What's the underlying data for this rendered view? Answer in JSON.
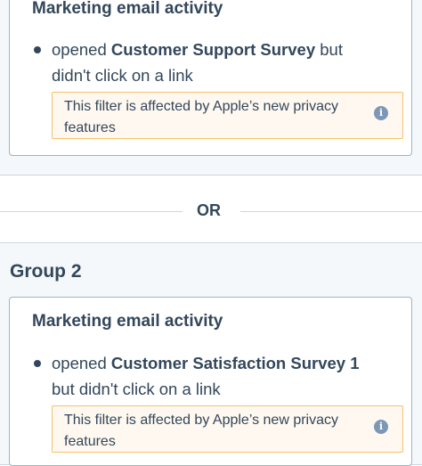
{
  "group1": {
    "filter": {
      "title": "Marketing email activity",
      "criterion": {
        "prefix": "opened ",
        "email_name": "Customer Support Survey",
        "line1_suffix": " but",
        "line2": "didn't click on a link"
      },
      "notice": {
        "text": "This filter is affected by Apple’s new privacy features",
        "icon": "info-icon"
      }
    }
  },
  "separator": {
    "label": "OR"
  },
  "group2": {
    "title": "Group 2",
    "filter": {
      "title": "Marketing email activity",
      "criterion": {
        "prefix": "opened ",
        "email_name": "Customer Satisfaction Survey 1",
        "line1_suffix": "",
        "line2": "but didn't click on a link"
      },
      "notice": {
        "text": "This filter is affected by Apple’s new privacy features",
        "icon": "info-icon"
      }
    }
  },
  "colors": {
    "panel_bg": "#f5f8fa",
    "card_border": "#9fb3c8",
    "notice_bg": "#fef8f0",
    "notice_border": "#f5c26b",
    "text": "#33475b"
  }
}
